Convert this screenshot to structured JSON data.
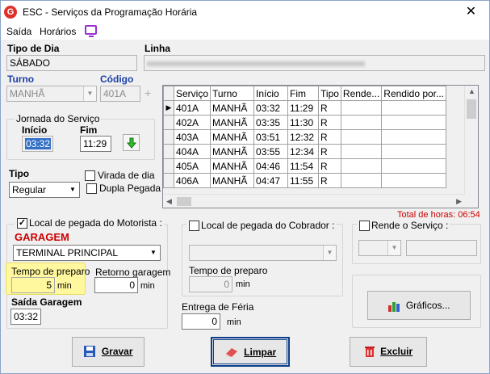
{
  "window": {
    "icon_text": "G",
    "title": "ESC - Serviços da Programação Horária",
    "close": "✕"
  },
  "menu": {
    "items": [
      "Saída",
      "Horários"
    ]
  },
  "header": {
    "tipo_dia_label": "Tipo de Dia",
    "tipo_dia_value": "SÁBADO",
    "linha_label": "Linha",
    "linha_value": "",
    "turno_label": "Turno",
    "turno_value": "MANHÃ",
    "codigo_label": "Código",
    "codigo_value": "401A",
    "plus": "+"
  },
  "jornada": {
    "title": "Jornada do Serviço",
    "inicio_label": "Início",
    "inicio_value": "03:32",
    "fim_label": "Fim",
    "fim_value": "11:29"
  },
  "tipo": {
    "label": "Tipo",
    "value": "Regular",
    "virada_label": "Virada de dia",
    "dupla_label": "Dupla Pegada"
  },
  "grid": {
    "columns": [
      "Serviço",
      "Turno",
      "Início",
      "Fim",
      "Tipo",
      "Rende...",
      "Rendido por..."
    ],
    "rows": [
      [
        "401A",
        "MANHÃ",
        "03:32",
        "11:29",
        "R",
        "",
        ""
      ],
      [
        "402A",
        "MANHÃ",
        "03:35",
        "11:30",
        "R",
        "",
        ""
      ],
      [
        "403A",
        "MANHÃ",
        "03:51",
        "12:32",
        "R",
        "",
        ""
      ],
      [
        "404A",
        "MANHÃ",
        "03:55",
        "12:34",
        "R",
        "",
        ""
      ],
      [
        "405A",
        "MANHÃ",
        "04:46",
        "11:54",
        "R",
        "",
        ""
      ],
      [
        "406A",
        "MANHÃ",
        "04:47",
        "11:55",
        "R",
        "",
        ""
      ]
    ],
    "total_label": "Total de horas: 06:54"
  },
  "motorista": {
    "check_label": "Local de pegada do Motorista :",
    "garagem_label": "GARAGEM",
    "local_value": "TERMINAL PRINCIPAL",
    "tempo_label": "Tempo de preparo",
    "tempo_value": "5",
    "tempo_unit": "min",
    "retorno_label": "Retorno garagem",
    "retorno_value": "0",
    "retorno_unit": "min",
    "saida_label": "Saída Garagem",
    "saida_value": "03:32"
  },
  "cobrador": {
    "check_label": "Local de pegada do Cobrador :",
    "tempo_label": "Tempo de preparo",
    "tempo_value": "0",
    "tempo_unit": "min",
    "entrega_label": "Entrega de Féria",
    "entrega_value": "0",
    "entrega_unit": "min"
  },
  "rende": {
    "check_label": "Rende o Serviço :"
  },
  "buttons": {
    "graficos": "Gráficos...",
    "gravar": "Gravar",
    "limpar": "Limpar",
    "excluir": "Excluir"
  },
  "colors": {
    "accent_blue": "#1a3fa6",
    "garagem_red": "#cc0000",
    "total_red": "#cc0000",
    "highlight": "#fff89e"
  }
}
